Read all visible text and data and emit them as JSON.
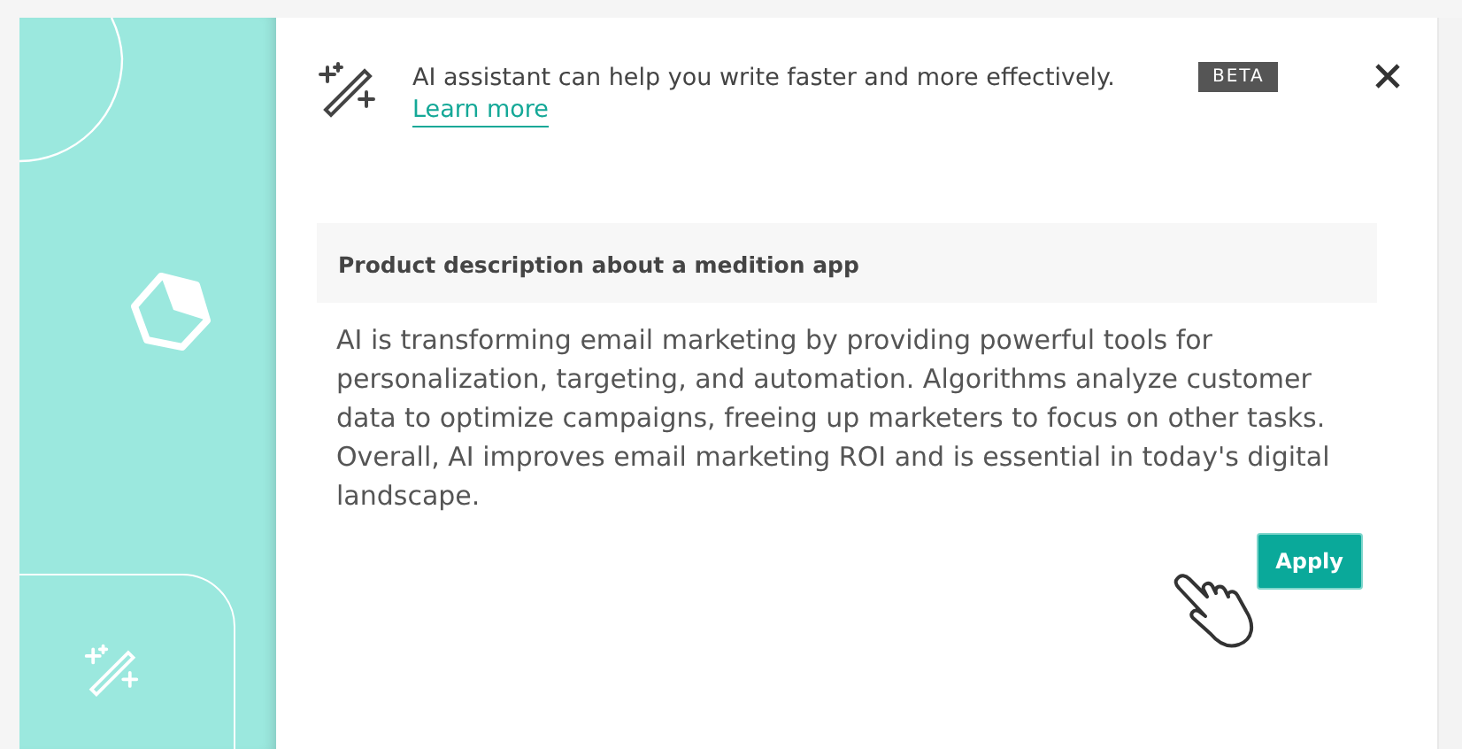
{
  "assistant": {
    "message": "AI assistant can help you write faster and more effectively.",
    "link": "Learn more",
    "badge": "BETA"
  },
  "prompt": {
    "text": "Product description about a medition app"
  },
  "response": {
    "text": "AI is transforming email marketing by providing powerful tools for personalization, targeting, and automation. Algorithms analyze customer data to optimize campaigns, freeing up marketers to focus on other tasks. Overall, AI improves email marketing ROI and is essential in today's digital landscape."
  },
  "apply_button": {
    "label": "Apply"
  }
}
